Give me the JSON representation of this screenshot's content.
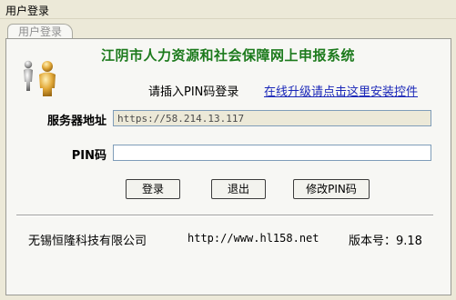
{
  "window": {
    "title": "用户登录"
  },
  "tab": {
    "label": "用户登录"
  },
  "header": {
    "title": "江阴市人力资源和社会保障网上申报系统"
  },
  "prompt": {
    "pin_login": "请插入PIN码登录",
    "upgrade_link": "在线升级请点击这里安装控件"
  },
  "form": {
    "server_label": "服务器地址",
    "server_value": "https://58.214.13.117",
    "pin_label": "PIN码",
    "pin_value": ""
  },
  "buttons": {
    "login": "登录",
    "exit": "退出",
    "change_pin": "修改PIN码"
  },
  "footer": {
    "company": "无锡恒隆科技有限公司",
    "url": "http://www.hl158.net",
    "version": "版本号：9.18"
  },
  "colors": {
    "title_green": "#1c7a1c",
    "link_blue": "#1a27b8",
    "background": "#ece9d8",
    "panel": "#f7f7f4"
  },
  "icons": {
    "logo": "people-users-icon"
  }
}
